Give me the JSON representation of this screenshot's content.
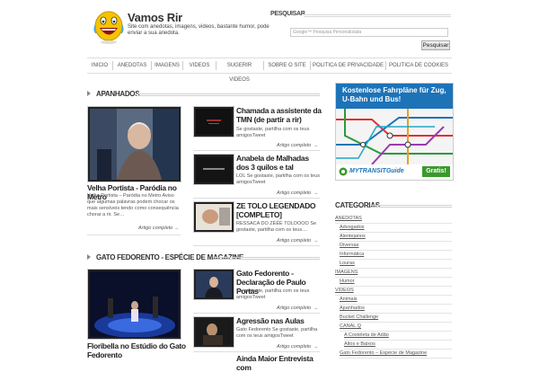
{
  "header": {
    "site_title": "Vamos Rir",
    "site_desc": "Site com anedotas, imagens, videos, bastante humor, pode enviar a sua anedota.",
    "search_label": "PESQUISAR",
    "search_placeholder": "Google™ Pesquisa Personalizada",
    "search_button": "Pesquisar"
  },
  "nav": [
    "INICIO",
    "ANEDOTAS",
    "IMAGENS",
    "VIDEOS",
    "SUGERIR VIDEOS",
    "SOBRE O SITE",
    "POLITICA DE PRIVACIDADE",
    "POLITICA DE COOKIES"
  ],
  "sections": [
    {
      "title": "APANHADOS",
      "featured": {
        "title": "Velha Portista - Paródia no Metro",
        "excerpt": "Velha Portista – Paródia no Metro Aviso que algumas palavras podem chocar os mais sensíveis tendo como consequência chorar a rir. Se…",
        "more": "Artigo completo"
      },
      "posts": [
        {
          "title": "Chamada a assistente da TMN (de partir a rir)",
          "excerpt": "Se gostaste, partilha com os teus amigosTweet",
          "more": "Artigo completo"
        },
        {
          "title": "Anabela de Malhadas dos 3 quilos e tal",
          "excerpt": "LOL Se gostaste, partilha com os teus amigosTweet",
          "more": "Artigo completo"
        },
        {
          "title": "ZE TOLO LEGENDADO [COMPLETO]",
          "excerpt": "RESSACA DO ZÉÉÉ TOLOOOO Se gostaste, partilha com os teus....",
          "more": "Artigo completo"
        }
      ]
    },
    {
      "title": "GATO FEDORENTO - ESPÉCIE DE MAGAZINE",
      "featured": {
        "title": "Floribella no Estúdio do Gato Fedorento"
      },
      "posts": [
        {
          "title": "Gato Fedorento - Declaração de Paulo Portas",
          "excerpt": "Se gostaste, partilha com os teus amigosTweet",
          "more": "Artigo completo"
        },
        {
          "title": "Agressão nas Aulas",
          "excerpt": "Gato Fedorento Se gostaste, partilha com os teus amigosTweet",
          "more": "Artigo completo"
        },
        {
          "title": "Ainda Maior Entrevista com"
        }
      ]
    }
  ],
  "ad": {
    "headline": "Kostenlose Fahrpläne für Zug, U-Bahn und Bus!",
    "brand": "MYTRANSITGuide",
    "cta": "Gratis!"
  },
  "categories": {
    "title": "CATEGORIAS",
    "items": [
      {
        "label": "ANEDOTAS",
        "level": 0
      },
      {
        "label": "Advogados",
        "level": 1
      },
      {
        "label": "Alentejanos",
        "level": 1
      },
      {
        "label": "Diversas",
        "level": 1
      },
      {
        "label": "Informática",
        "level": 1
      },
      {
        "label": "Louras",
        "level": 1
      },
      {
        "label": "IMAGENS",
        "level": 0
      },
      {
        "label": "Humor",
        "level": 1
      },
      {
        "label": "VIDEOS",
        "level": 0
      },
      {
        "label": "Animais",
        "level": 1
      },
      {
        "label": "Apanhados",
        "level": 1
      },
      {
        "label": "Bucket Challenge",
        "level": 1
      },
      {
        "label": "CANAL Q",
        "level": 1
      },
      {
        "label": "A Costeleta de Adão",
        "level": 2
      },
      {
        "label": "Altos e Baixos",
        "level": 2
      },
      {
        "label": "Gato Fedorento – Espécie de Magazine",
        "level": 1
      }
    ]
  },
  "colors": {
    "ad_blue": "#1d73b8",
    "ad_green": "#3a9a2b"
  }
}
